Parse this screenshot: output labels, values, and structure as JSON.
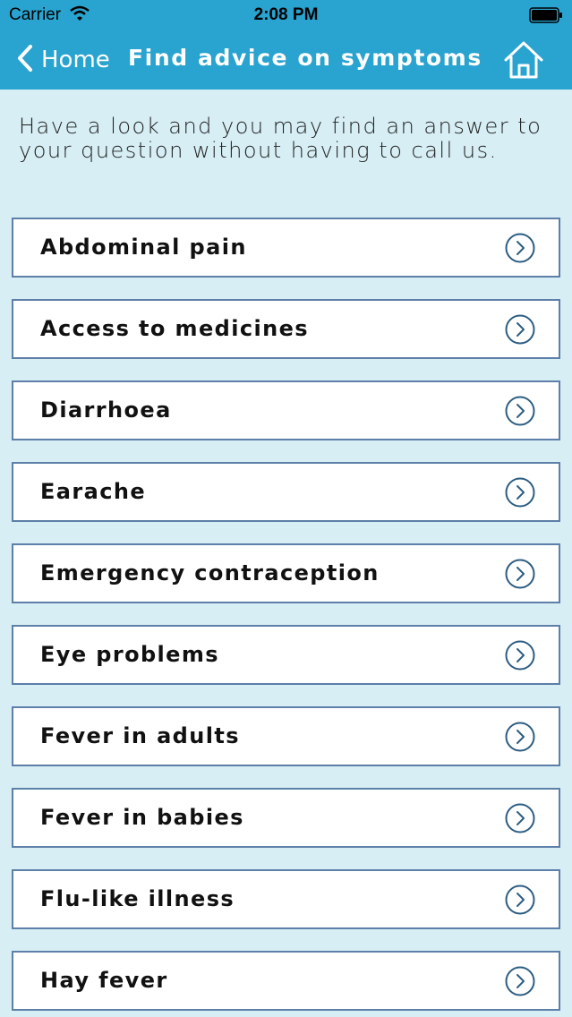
{
  "status": {
    "carrier": "Carrier",
    "time": "2:08 PM"
  },
  "nav": {
    "back_label": "Home",
    "title": "Find advice on symptoms"
  },
  "intro": "Have a look and you may find an answer to your question without having to call us.",
  "symptoms": [
    "Abdominal pain",
    "Access to medicines",
    "Diarrhoea",
    "Earache",
    "Emergency contraception",
    "Eye problems",
    "Fever in adults",
    "Fever in babies",
    "Flu-like illness",
    "Hay fever"
  ],
  "colors": {
    "header": "#29a3cf",
    "background": "#d6eef4",
    "border": "#5d7fa8",
    "chevron": "#2c5d82"
  }
}
